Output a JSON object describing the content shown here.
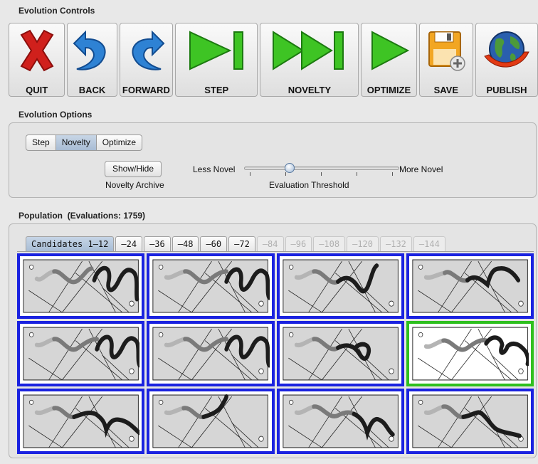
{
  "toolbar": {
    "title": "Evolution Controls",
    "buttons": [
      {
        "id": "quit",
        "label": "QUIT",
        "icon": "red-x-icon"
      },
      {
        "id": "back",
        "label": "BACK",
        "icon": "undo-arrow-icon"
      },
      {
        "id": "forward",
        "label": "FORWARD",
        "icon": "redo-arrow-icon"
      },
      {
        "id": "step",
        "label": "STEP",
        "icon": "step-forward-icon"
      },
      {
        "id": "novelty",
        "label": "NOVELTY",
        "icon": "fast-forward-icon"
      },
      {
        "id": "optimize",
        "label": "OPTIMIZE",
        "icon": "play-icon"
      },
      {
        "id": "save",
        "label": "SAVE",
        "icon": "floppy-disk-icon"
      },
      {
        "id": "publish",
        "label": "PUBLISH",
        "icon": "globe-icon"
      }
    ]
  },
  "options": {
    "title": "Evolution Options",
    "modes": [
      "Step",
      "Novelty",
      "Optimize"
    ],
    "selected_mode": "Novelty",
    "show_hide_label": "Show/Hide",
    "archive_label": "Novelty Archive",
    "slider_left": "Less Novel",
    "slider_right": "More Novel",
    "slider_caption": "Evaluation Threshold",
    "slider_value": 0.28
  },
  "population": {
    "title": "Population",
    "evaluations": "(Evaluations: 1759)",
    "tabs": [
      {
        "label": "Candidates 1–12",
        "state": "active"
      },
      {
        "label": "–24",
        "state": "enabled"
      },
      {
        "label": "–36",
        "state": "enabled"
      },
      {
        "label": "–48",
        "state": "enabled"
      },
      {
        "label": "–60",
        "state": "enabled"
      },
      {
        "label": "–72",
        "state": "enabled"
      },
      {
        "label": "–84",
        "state": "disabled"
      },
      {
        "label": "–96",
        "state": "disabled"
      },
      {
        "label": "–108",
        "state": "disabled"
      },
      {
        "label": "–120",
        "state": "disabled"
      },
      {
        "label": "–132",
        "state": "disabled"
      },
      {
        "label": "–144",
        "state": "disabled"
      }
    ],
    "selected_candidate": 8,
    "candidate_count": 12
  },
  "colors": {
    "candidate_border": "#1a22e0",
    "selected_border": "#2ec01e",
    "tab_active": "#b6c8dd"
  }
}
